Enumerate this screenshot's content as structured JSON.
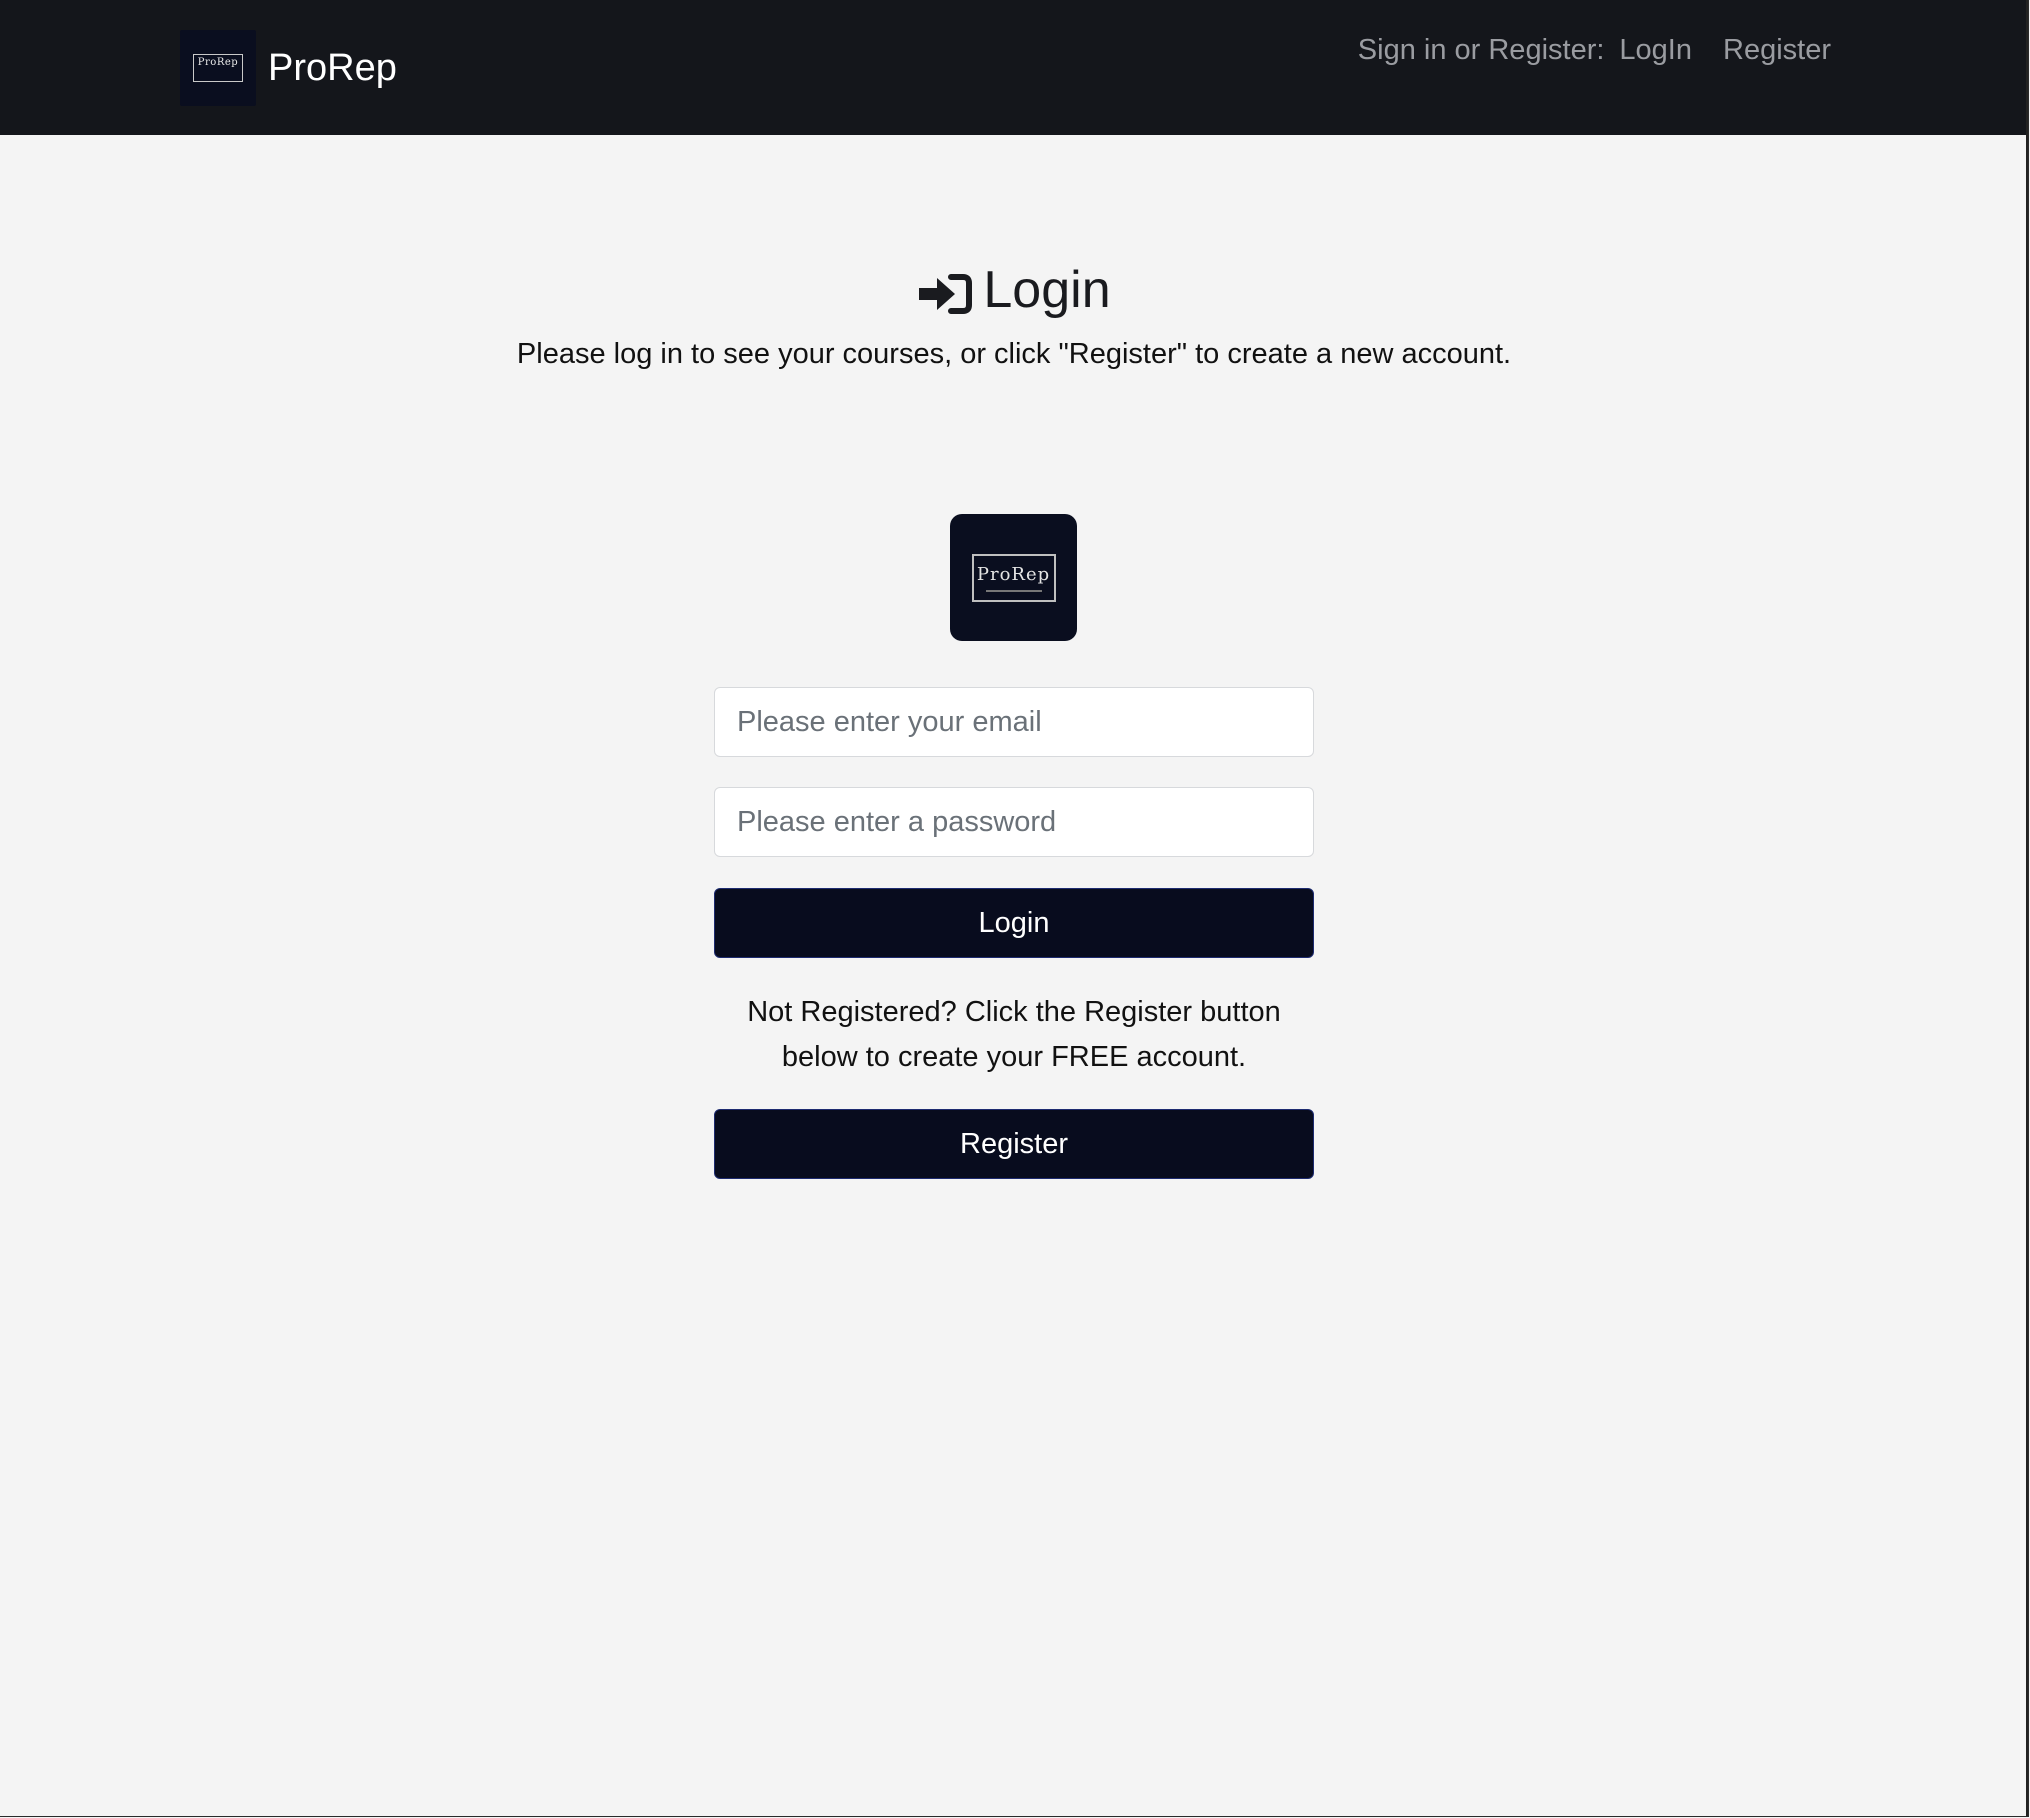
{
  "navbar": {
    "brand_name": "ProRep",
    "brand_logo_text": "ProRep",
    "nav_prefix": "Sign in or Register:",
    "login_link": "LogIn",
    "register_link": "Register"
  },
  "header": {
    "title": "Login",
    "subtitle": "Please log in to see your courses, or click \"Register\" to create a new account."
  },
  "logo": {
    "text": "ProRep"
  },
  "form": {
    "email_placeholder": "Please enter your email",
    "email_value": "",
    "password_placeholder": "Please enter a password",
    "password_value": "",
    "login_button": "Login",
    "helper_text": "Not Registered? Click the Register button below to create your FREE account.",
    "register_button": "Register"
  },
  "colors": {
    "navbar_bg": "#14161b",
    "page_bg": "#f4f4f4",
    "button_bg": "#080c1e",
    "button_border": "#1d2b70",
    "nav_link": "#9a9ca1"
  },
  "icons": {
    "title_icon": "sign-in-arrow-icon"
  }
}
